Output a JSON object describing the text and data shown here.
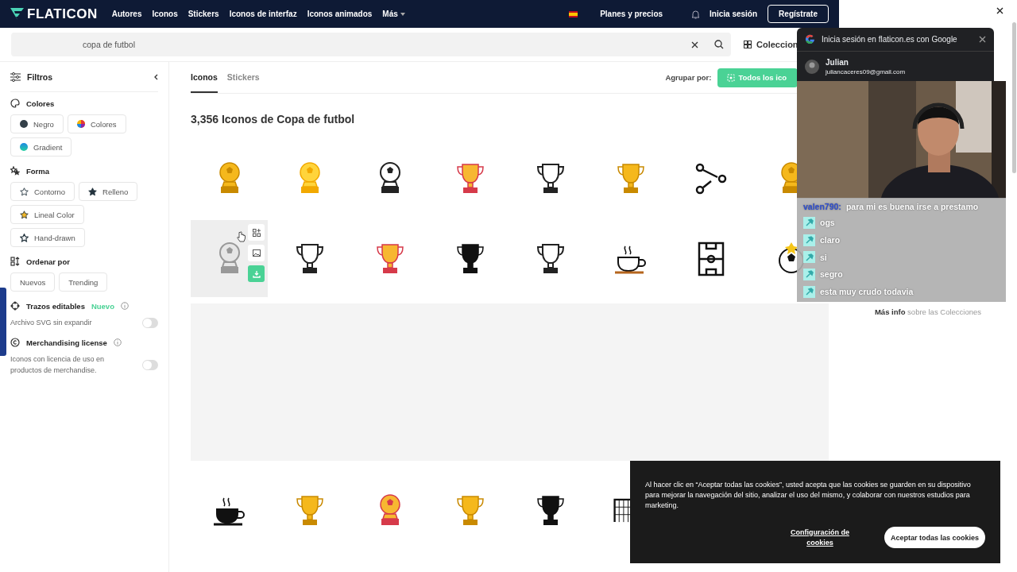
{
  "header": {
    "logo": "FLATICON",
    "nav": [
      "Autores",
      "Iconos",
      "Stickers",
      "Iconos de interfaz",
      "Iconos animados",
      "Más"
    ],
    "plans": "Planes y precios",
    "login": "Inicia sesión",
    "register": "Regístrate"
  },
  "search": {
    "value": "copa de futbol",
    "collections": "Coleccion"
  },
  "filters": {
    "title": "Filtros",
    "sections": [
      {
        "kind": "chips",
        "title": "Colores",
        "chips": [
          {
            "label": "Negro"
          },
          {
            "label": "Colores"
          },
          {
            "label": "Gradient"
          }
        ]
      },
      {
        "kind": "chips",
        "title": "Forma",
        "chips": [
          {
            "label": "Contorno"
          },
          {
            "label": "Relleno"
          },
          {
            "label": "Lineal Color"
          },
          {
            "label": "Hand-drawn"
          }
        ]
      },
      {
        "kind": "chips",
        "title": "Ordenar por",
        "chips": [
          {
            "label": "Nuevos"
          },
          {
            "label": "Trending"
          }
        ]
      },
      {
        "kind": "toggle",
        "title": "Trazos editables",
        "badge": "Nuevo",
        "text": "Archivo SVG sin expandir",
        "on": false
      },
      {
        "kind": "toggle",
        "title": "Merchandising license",
        "text": "Iconos con licencia de uso en productos de merchandise.",
        "on": false
      }
    ]
  },
  "tabs": [
    {
      "label": "Iconos",
      "selected": true
    },
    {
      "label": "Stickers",
      "selected": false
    }
  ],
  "group_by": {
    "label": "Agrupar por:",
    "button": "Todos los ico"
  },
  "heading": "3,356 Iconos de Copa de futbol",
  "icon_rows": [
    [
      {
        "kind": "goldballtrophy"
      },
      {
        "kind": "yellowballtrophy"
      },
      {
        "kind": "outlineballtrophy"
      },
      {
        "kind": "colortrophy"
      },
      {
        "kind": "outlinetrophy"
      },
      {
        "kind": "goldtrophy"
      },
      {
        "kind": "tactics"
      },
      {
        "kind": "goldballtrophy"
      }
    ],
    [
      {
        "kind": "grayballtrophy",
        "hovered": true
      },
      {
        "kind": "outlinetrophy"
      },
      {
        "kind": "colortrophy"
      },
      {
        "kind": "blacktrophy"
      },
      {
        "kind": "outlinetrophy"
      },
      {
        "kind": "coffeecup"
      },
      {
        "kind": "pitch"
      },
      {
        "kind": "starball"
      }
    ],
    [
      {
        "kind": "blackcup"
      },
      {
        "kind": "goldtrophy"
      },
      {
        "kind": "colorballtrophy"
      },
      {
        "kind": "goldtrophy"
      },
      {
        "kind": "blacktrophy"
      },
      {
        "kind": "goal"
      }
    ]
  ],
  "side_panel": {
    "more_info": "Más info",
    "more_info_rest": "sobre las Colecciones"
  },
  "google_popup": {
    "title": "Inicia sesión en flaticon.es con Google",
    "name": "Julian",
    "email": "juliancaceres09@gmail.com"
  },
  "chat": [
    {
      "name": "valen790:",
      "text": "para mi es buena irse a prestamo",
      "badge": false
    },
    {
      "text": "ogs",
      "badge": true
    },
    {
      "text": "claro",
      "badge": true
    },
    {
      "text": "si",
      "badge": true
    },
    {
      "text": "segro",
      "badge": true
    },
    {
      "text": "esta muy crudo todavia",
      "badge": true
    }
  ],
  "cookies": {
    "text": "Al hacer clic en “Aceptar todas las cookies”, usted acepta que las cookies se guarden en su dispositivo para mejorar la navegación del sitio, analizar el uso del mismo, y colaborar con nuestros estudios para marketing.",
    "settings": "Configuración de cookies",
    "accept": "Aceptar todas las cookies"
  }
}
